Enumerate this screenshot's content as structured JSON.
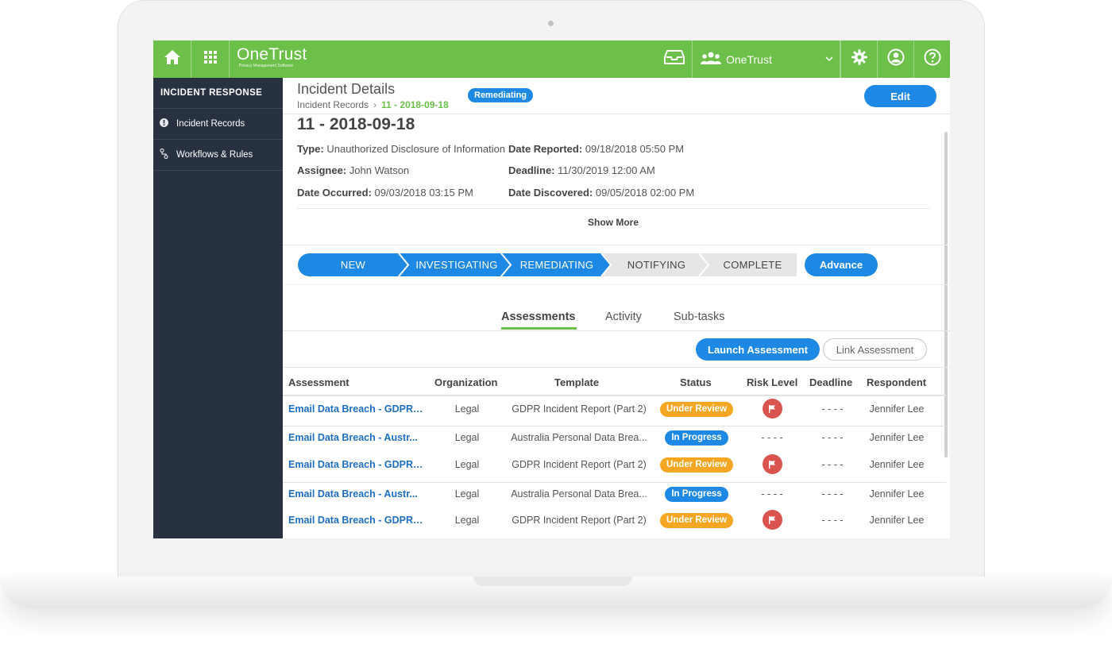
{
  "app": {
    "logo_name": "OneTrust",
    "logo_tagline": "Privacy Management Software",
    "org_selector": "OneTrust"
  },
  "colors": {
    "brand_green": "#6cc04a",
    "primary_blue": "#1e88e5",
    "sidebar_bg": "#283140",
    "under_review": "#f5a623",
    "in_progress": "#1e88e5",
    "risk_red": "#d9534f",
    "step_inactive": "#e6e6e6"
  },
  "icons": {
    "home": "home-icon",
    "apps": "grid-icon",
    "inbox": "inbox-icon",
    "org": "users-icon",
    "settings": "gear-icon",
    "profile": "user-circle-icon",
    "help": "help-icon"
  },
  "sidebar": {
    "title": "INCIDENT RESPONSE",
    "items": [
      {
        "label": "Incident Records",
        "icon": "alert-circle-icon"
      },
      {
        "label": "Workflows & Rules",
        "icon": "workflow-icon"
      }
    ]
  },
  "header": {
    "title": "Incident Details",
    "breadcrumb_parent": "Incident Records",
    "breadcrumb_sep": "›",
    "breadcrumb_current": "11 - 2018-09-18",
    "status_badge": "Remediating",
    "edit_label": "Edit"
  },
  "record": {
    "title": "11 - 2018-09-18",
    "type_label": "Type:",
    "type_value": "Unauthorized Disclosure of Information",
    "date_reported_label": "Date Reported:",
    "date_reported_value": "09/18/2018 05:50 PM",
    "assignee_label": "Assignee:",
    "assignee_value": "John Watson",
    "deadline_label": "Deadline:",
    "deadline_value": "11/30/2019 12:00 AM",
    "date_occurred_label": "Date Occurred:",
    "date_occurred_value": "09/03/2018 03:15 PM",
    "date_discovered_label": "Date Discovered:",
    "date_discovered_value": "09/05/2018 02:00 PM",
    "show_more": "Show More"
  },
  "stepper": {
    "steps": [
      {
        "label": "NEW",
        "state": "done"
      },
      {
        "label": "INVESTIGATING",
        "state": "done"
      },
      {
        "label": "REMEDIATING",
        "state": "current"
      },
      {
        "label": "NOTIFYING",
        "state": "todo"
      },
      {
        "label": "COMPLETE",
        "state": "todo"
      }
    ],
    "advance_label": "Advance"
  },
  "tabs": {
    "items": [
      "Assessments",
      "Activity",
      "Sub-tasks"
    ],
    "active": "Assessments"
  },
  "actions": {
    "launch_label": "Launch Assessment",
    "link_label": "Link Assessment"
  },
  "table": {
    "columns": [
      "Assessment",
      "Organization",
      "Template",
      "Status",
      "Risk Level",
      "Deadline",
      "Respondent"
    ],
    "rows": [
      {
        "assessment": "Email Data Breach - GDPR ...",
        "organization": "Legal",
        "template": "GDPR Incident Report (Part 2)",
        "status": "Under Review",
        "status_kind": "under_review",
        "risk": "flag",
        "risk_display": "",
        "deadline": "- - - -",
        "respondent": "Jennifer Lee"
      },
      {
        "assessment": "Email Data Breach - Austr...",
        "organization": "Legal",
        "template": "Australia Personal Data Brea...",
        "status": "In Progress",
        "status_kind": "in_progress",
        "risk": "none",
        "risk_display": "- - - -",
        "deadline": "- - - -",
        "respondent": "Jennifer Lee"
      },
      {
        "assessment": "Email Data Breach - GDPR ...",
        "organization": "Legal",
        "template": "GDPR Incident Report (Part 2)",
        "status": "Under Review",
        "status_kind": "under_review",
        "risk": "flag",
        "risk_display": "",
        "deadline": "- - - -",
        "respondent": "Jennifer Lee"
      },
      {
        "assessment": "Email Data Breach - Austr...",
        "organization": "Legal",
        "template": "Australia Personal Data Brea...",
        "status": "In Progress",
        "status_kind": "in_progress",
        "risk": "none",
        "risk_display": "- - - -",
        "deadline": "- - - -",
        "respondent": "Jennifer Lee"
      },
      {
        "assessment": "Email Data Breach - GDPR ...",
        "organization": "Legal",
        "template": "GDPR Incident Report (Part 2)",
        "status": "Under Review",
        "status_kind": "under_review",
        "risk": "flag",
        "risk_display": "",
        "deadline": "- - - -",
        "respondent": "Jennifer Lee"
      }
    ]
  }
}
